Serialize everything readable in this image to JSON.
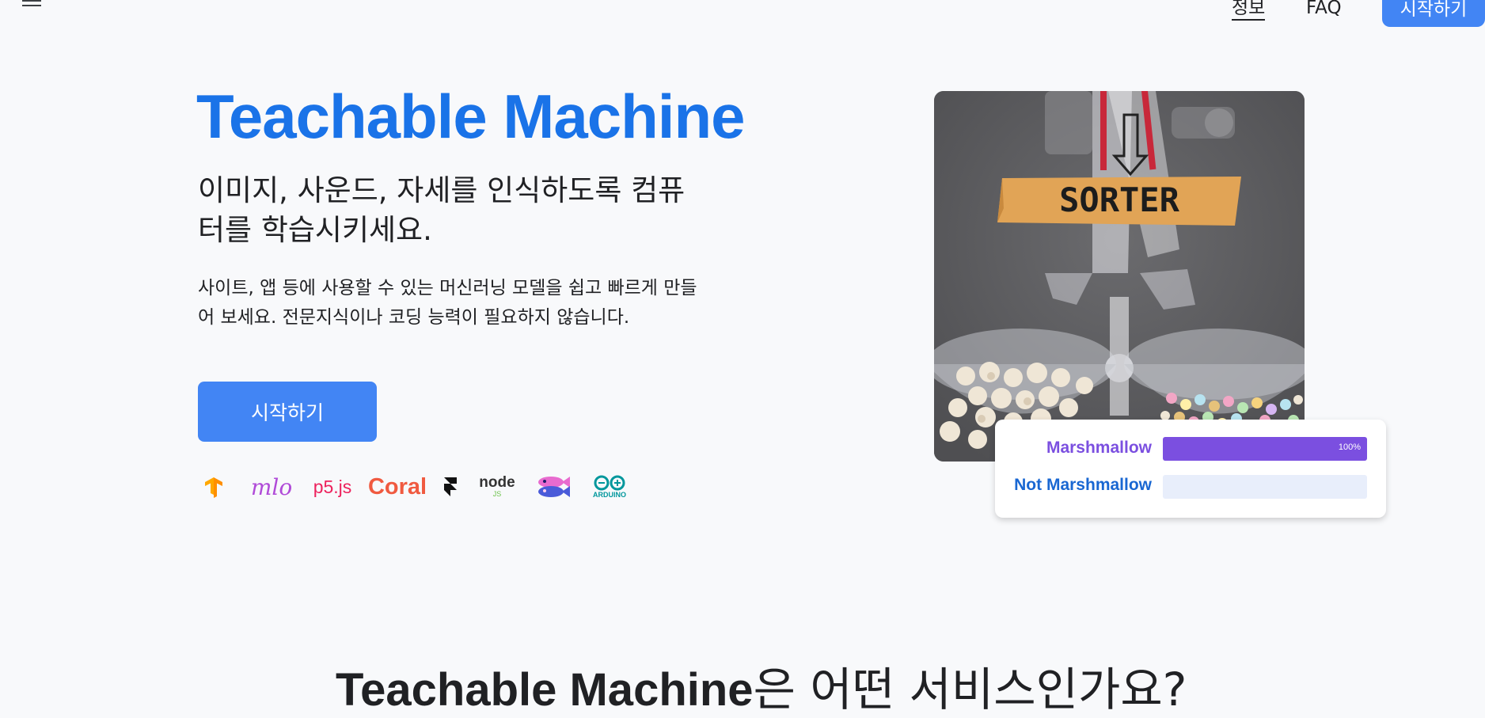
{
  "header": {
    "menu_icon": "hamburger-menu-icon",
    "nav": {
      "about": "정보",
      "faq": "FAQ",
      "get_started": "시작하기"
    }
  },
  "hero": {
    "title": "Teachable Machine",
    "subtitle": "이미지, 사운드, 자세를 인식하도록 컴퓨터를 학습시키세요.",
    "description": "사이트, 앱 등에 사용할 수 있는 머신러닝 모델을 쉽고 빠르게 만들어 보세요. 전문지식이나 코딩 능력이 필요하지 않습니다.",
    "cta_label": "시작하기",
    "logos": {
      "tensorflow": "tensorflow-logo-icon",
      "ml5": "mlo",
      "p5": "p5.js",
      "coral": "Coral",
      "framer": "framer-logo-icon",
      "node": "node",
      "node_sub": "JS",
      "glitch": "glitch-fish-logo-icon",
      "arduino": "ARDUINO"
    }
  },
  "image": {
    "label_text": "SORTER"
  },
  "prediction": {
    "classes": [
      {
        "label": "Marshmallow",
        "percent_text": "100%",
        "value": 1.0,
        "color": "#7b4fe0"
      },
      {
        "label": "Not Marshmallow",
        "percent_text": "",
        "value": 0.0,
        "color": "#1967d2"
      }
    ]
  },
  "section": {
    "heading_bold": "Teachable Machine",
    "heading_rest": "은 어떤 서비스인가요?"
  },
  "colors": {
    "brand_blue": "#1a73e8",
    "button_blue": "#4285f4",
    "purple": "#7b4fe0",
    "background": "#f8f9fb"
  }
}
